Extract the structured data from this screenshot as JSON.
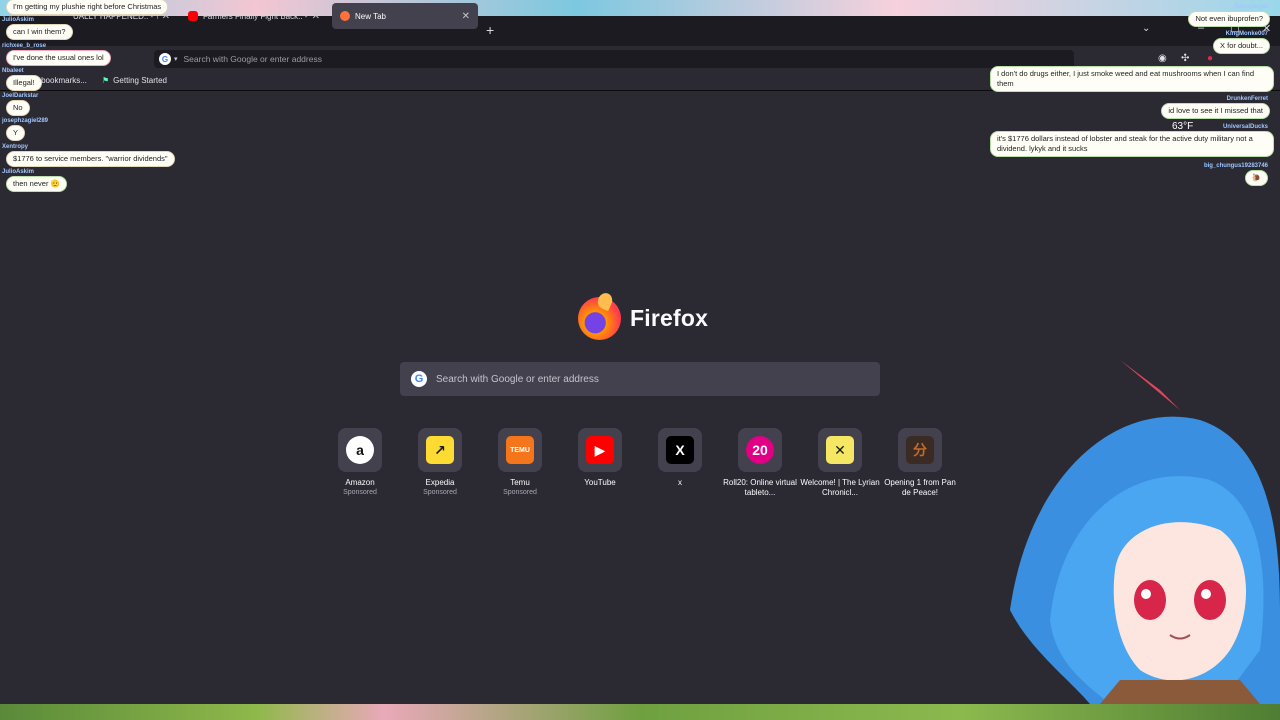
{
  "tabs": [
    {
      "title": "UALLY HAPPENED.. - You",
      "favicon_color": "#ff0000"
    },
    {
      "title": "Farmers Finally Fight Back.. - Yo",
      "favicon_color": "#ff0000"
    },
    {
      "title": "New Tab",
      "favicon_color": "#ff7139"
    }
  ],
  "toolbar": {
    "url_placeholder": "Search with Google or enter address",
    "search_engine_letter": "G"
  },
  "bookmarks": {
    "import_label": "rt bookmarks...",
    "items": [
      "Getting Started"
    ]
  },
  "newtab": {
    "brand": "Firefox",
    "search_placeholder": "Search with Google or enter address",
    "shortcuts": [
      {
        "label": "Amazon",
        "sponsored": "Sponsored",
        "icon": "amazon-icon",
        "glyph": "a",
        "bg": "#ffffff",
        "fg": "#111111"
      },
      {
        "label": "Expedia",
        "sponsored": "Sponsored",
        "icon": "expedia-icon",
        "glyph": "↗",
        "bg": "#fddb32",
        "fg": "#1a1a1a"
      },
      {
        "label": "Temu",
        "sponsored": "Sponsored",
        "icon": "temu-icon",
        "glyph": "TEMU",
        "bg": "#f5761a",
        "fg": "#ffffff"
      },
      {
        "label": "YouTube",
        "sponsored": "",
        "icon": "youtube-icon",
        "glyph": "▶",
        "bg": "#ff0000",
        "fg": "#ffffff"
      },
      {
        "label": "x",
        "sponsored": "",
        "icon": "x-icon",
        "glyph": "X",
        "bg": "#000000",
        "fg": "#ffffff"
      },
      {
        "label": "Roll20: Online virtual tableto...",
        "sponsored": "",
        "icon": "roll20-icon",
        "glyph": "20",
        "bg": "#e10085",
        "fg": "#ffffff"
      },
      {
        "label": "Welcome! | The Lyrian Chronicl...",
        "sponsored": "",
        "icon": "lyrian-icon",
        "glyph": "✕",
        "bg": "#f5e663",
        "fg": "#1a1a1a"
      },
      {
        "label": "Opening 1 from Pan de Peace!",
        "sponsored": "",
        "icon": "pan-de-peace-icon",
        "glyph": "分",
        "bg": "#3a2c24",
        "fg": "#c26b2a"
      }
    ]
  },
  "chat_left": [
    {
      "name": "",
      "text": "I'm getting my plushie right before Christmas",
      "border": "default"
    },
    {
      "name": "JulioAskim",
      "text": "can I win them?",
      "border": "default"
    },
    {
      "name": "richxee_b_rose",
      "text": "I've done the usual ones lol",
      "border": "pink"
    },
    {
      "name": "Nbaleet",
      "text": "Illegal!",
      "border": "default"
    },
    {
      "name": "JoelDarkstar",
      "text": "No",
      "border": "default"
    },
    {
      "name": "josephzagiel289",
      "text": "Y",
      "border": "default"
    },
    {
      "name": "Xentropy",
      "text": "$1776 to service members. \"warrior dividends\"",
      "border": "default"
    },
    {
      "name": "JulioAskim",
      "text": "then never 🫡",
      "border": "green"
    }
  ],
  "chat_right": [
    {
      "name": "Tulcavaryar",
      "text": "Not even ibuprofen?"
    },
    {
      "name": "KingMonke007",
      "text": "X for doubt..."
    },
    {
      "name": "",
      "text": "I don't do drugs either, I just smoke weed and eat mushrooms when I can find them"
    },
    {
      "name": "DrunkenFerret",
      "text": "id love to see it I missed that"
    },
    {
      "name": "UniversalDucks",
      "text": "it's $1776 dollars instead of lobster and steak for the active duty military not a dividend. lykyk and it sucks"
    },
    {
      "name": "big_chungus19283746",
      "text": "🐌"
    }
  ],
  "weather": "63°F"
}
